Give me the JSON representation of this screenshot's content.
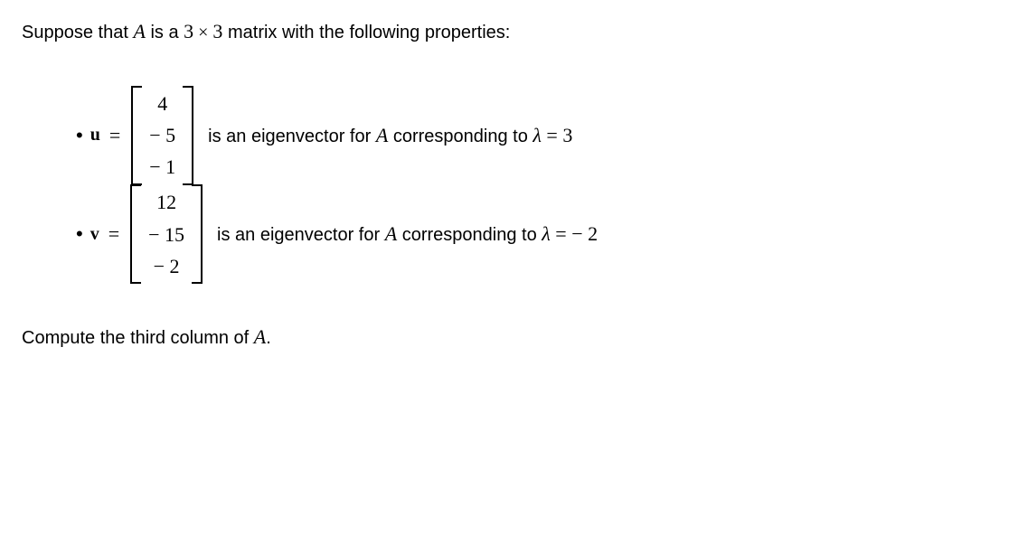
{
  "intro": {
    "prefix": "Suppose that ",
    "A": "A",
    "mid1": " is a ",
    "dim1": "3",
    "times": " × ",
    "dim2": "3",
    "suffix": " matrix with the following properties:"
  },
  "items": [
    {
      "vec_name": "u",
      "entries": [
        "4",
        "− 5",
        "− 1"
      ],
      "desc_prefix": "is an eigenvector for ",
      "A": "A",
      "desc_mid": " corresponding to ",
      "lambda": "λ",
      "eq": " = ",
      "value": "3"
    },
    {
      "vec_name": "v",
      "entries": [
        "12",
        "− 15",
        "− 2"
      ],
      "desc_prefix": "is an eigenvector for ",
      "A": "A",
      "desc_mid": " corresponding to ",
      "lambda": "λ",
      "eq": " = ",
      "value": " − 2"
    }
  ],
  "question": {
    "prefix": "Compute the third column of ",
    "A": "A",
    "suffix": "."
  }
}
